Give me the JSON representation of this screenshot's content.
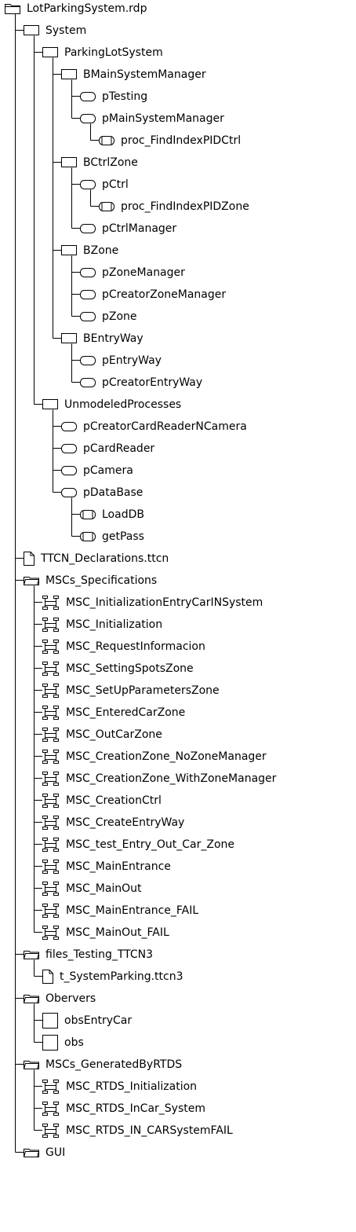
{
  "tree": [
    {
      "label": "LotParkingSystem.rdp",
      "depth": 0,
      "icon": "project-folder-icon",
      "kind": "folder-tab-open"
    },
    {
      "label": "System",
      "depth": 1,
      "icon": "system-icon",
      "kind": "rect"
    },
    {
      "label": "ParkingLotSystem",
      "depth": 2,
      "icon": "block-icon",
      "kind": "rect"
    },
    {
      "label": "BMainSystemManager",
      "depth": 3,
      "icon": "block-icon",
      "kind": "rect"
    },
    {
      "label": "pTesting",
      "depth": 4,
      "icon": "process-icon",
      "kind": "pill"
    },
    {
      "label": "pMainSystemManager",
      "depth": 4,
      "icon": "process-icon",
      "kind": "pill"
    },
    {
      "label": "proc_FindIndexPIDCtrl",
      "depth": 5,
      "icon": "procedure-icon",
      "kind": "proc"
    },
    {
      "label": "BCtrlZone",
      "depth": 3,
      "icon": "block-icon",
      "kind": "rect"
    },
    {
      "label": "pCtrl",
      "depth": 4,
      "icon": "process-icon",
      "kind": "pill"
    },
    {
      "label": "proc_FindIndexPIDZone",
      "depth": 5,
      "icon": "procedure-icon",
      "kind": "proc"
    },
    {
      "label": "pCtrlManager",
      "depth": 4,
      "icon": "process-icon",
      "kind": "pill"
    },
    {
      "label": "BZone",
      "depth": 3,
      "icon": "block-icon",
      "kind": "rect"
    },
    {
      "label": "pZoneManager",
      "depth": 4,
      "icon": "process-icon",
      "kind": "pill"
    },
    {
      "label": "pCreatorZoneManager",
      "depth": 4,
      "icon": "process-icon",
      "kind": "pill"
    },
    {
      "label": "pZone",
      "depth": 4,
      "icon": "process-icon",
      "kind": "pill"
    },
    {
      "label": "BEntryWay",
      "depth": 3,
      "icon": "block-icon",
      "kind": "rect"
    },
    {
      "label": "pEntryWay",
      "depth": 4,
      "icon": "process-icon",
      "kind": "pill"
    },
    {
      "label": "pCreatorEntryWay",
      "depth": 4,
      "icon": "process-icon",
      "kind": "pill"
    },
    {
      "label": "UnmodeledProcesses",
      "depth": 2,
      "icon": "block-icon",
      "kind": "rect"
    },
    {
      "label": "pCreatorCardReaderNCamera",
      "depth": 3,
      "icon": "process-icon",
      "kind": "pill"
    },
    {
      "label": "pCardReader",
      "depth": 3,
      "icon": "process-icon",
      "kind": "pill"
    },
    {
      "label": "pCamera",
      "depth": 3,
      "icon": "process-icon",
      "kind": "pill"
    },
    {
      "label": "pDataBase",
      "depth": 3,
      "icon": "process-icon",
      "kind": "pill"
    },
    {
      "label": "LoadDB",
      "depth": 4,
      "icon": "procedure-icon",
      "kind": "proc"
    },
    {
      "label": "getPass",
      "depth": 4,
      "icon": "procedure-icon",
      "kind": "proc"
    },
    {
      "label": "TTCN_Declarations.ttcn",
      "depth": 1,
      "icon": "file-icon",
      "kind": "file"
    },
    {
      "label": "MSCs_Specifications",
      "depth": 1,
      "icon": "folder-icon",
      "kind": "folder"
    },
    {
      "label": "MSC_InitializationEntryCarINSystem",
      "depth": 2,
      "icon": "msc-icon",
      "kind": "msc"
    },
    {
      "label": "MSC_Initialization",
      "depth": 2,
      "icon": "msc-icon",
      "kind": "msc"
    },
    {
      "label": "MSC_RequestInformacion",
      "depth": 2,
      "icon": "msc-icon",
      "kind": "msc"
    },
    {
      "label": "MSC_SettingSpotsZone",
      "depth": 2,
      "icon": "msc-icon",
      "kind": "msc"
    },
    {
      "label": "MSC_SetUpParametersZone",
      "depth": 2,
      "icon": "msc-icon",
      "kind": "msc"
    },
    {
      "label": "MSC_EnteredCarZone",
      "depth": 2,
      "icon": "msc-icon",
      "kind": "msc"
    },
    {
      "label": "MSC_OutCarZone",
      "depth": 2,
      "icon": "msc-icon",
      "kind": "msc"
    },
    {
      "label": "MSC_CreationZone_NoZoneManager",
      "depth": 2,
      "icon": "msc-icon",
      "kind": "msc"
    },
    {
      "label": "MSC_CreationZone_WithZoneManager",
      "depth": 2,
      "icon": "msc-icon",
      "kind": "msc"
    },
    {
      "label": "MSC_CreationCtrl",
      "depth": 2,
      "icon": "msc-icon",
      "kind": "msc"
    },
    {
      "label": "MSC_CreateEntryWay",
      "depth": 2,
      "icon": "msc-icon",
      "kind": "msc"
    },
    {
      "label": "MSC_test_Entry_Out_Car_Zone",
      "depth": 2,
      "icon": "msc-icon",
      "kind": "msc"
    },
    {
      "label": "MSC_MainEntrance",
      "depth": 2,
      "icon": "msc-icon",
      "kind": "msc"
    },
    {
      "label": "MSC_MainOut",
      "depth": 2,
      "icon": "msc-icon",
      "kind": "msc"
    },
    {
      "label": "MSC_MainEntrance_FAIL",
      "depth": 2,
      "icon": "msc-icon",
      "kind": "msc"
    },
    {
      "label": "MSC_MainOut_FAIL",
      "depth": 2,
      "icon": "msc-icon",
      "kind": "msc"
    },
    {
      "label": "files_Testing_TTCN3",
      "depth": 1,
      "icon": "folder-icon",
      "kind": "folder"
    },
    {
      "label": "t_SystemParking.ttcn3",
      "depth": 2,
      "icon": "file-icon",
      "kind": "file"
    },
    {
      "label": "Obervers",
      "depth": 1,
      "icon": "folder-icon",
      "kind": "folder"
    },
    {
      "label": "obsEntryCar",
      "depth": 2,
      "icon": "observer-icon",
      "kind": "square"
    },
    {
      "label": "obs",
      "depth": 2,
      "icon": "observer-icon",
      "kind": "square"
    },
    {
      "label": "MSCs_GeneratedByRTDS",
      "depth": 1,
      "icon": "folder-icon",
      "kind": "folder"
    },
    {
      "label": "MSC_RTDS_Initialization",
      "depth": 2,
      "icon": "msc-icon",
      "kind": "msc"
    },
    {
      "label": "MSC_RTDS_InCar_System",
      "depth": 2,
      "icon": "msc-icon",
      "kind": "msc"
    },
    {
      "label": "MSC_RTDS_IN_CARSystemFAIL",
      "depth": 2,
      "icon": "msc-icon",
      "kind": "msc"
    },
    {
      "label": "GUI",
      "depth": 1,
      "icon": "folder-icon",
      "kind": "folder"
    }
  ]
}
